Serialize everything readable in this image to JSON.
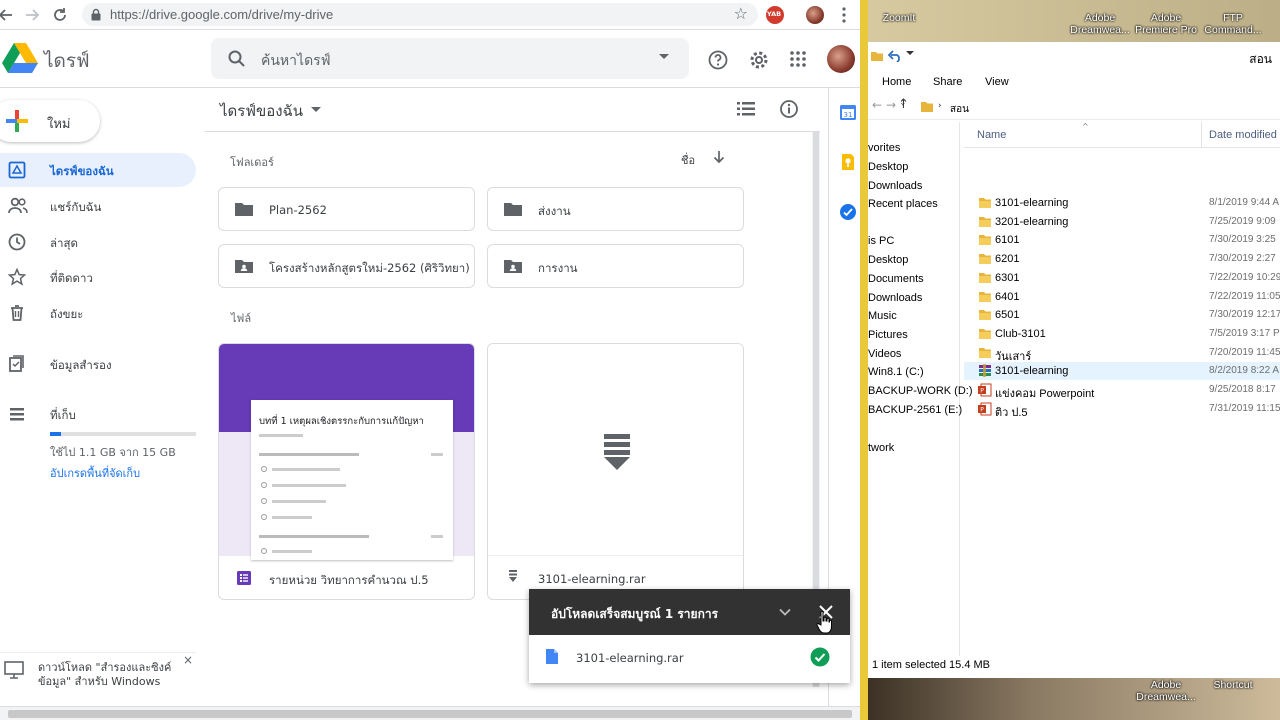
{
  "browser": {
    "url": "https://drive.google.com/drive/my-drive",
    "ext_label": "YAB"
  },
  "drive": {
    "logo_text": "ไดรฟ์",
    "search_placeholder": "ค้นหาไดรฟ์",
    "new_label": "ใหม่",
    "sidebar": [
      {
        "label": "ไดรฟ์ของฉัน",
        "icon": "my-drive-icon"
      },
      {
        "label": "แชร์กับฉัน",
        "icon": "shared-icon"
      },
      {
        "label": "ล่าสุด",
        "icon": "clock-icon"
      },
      {
        "label": "ที่ติดดาว",
        "icon": "star-icon"
      },
      {
        "label": "ถังขยะ",
        "icon": "trash-icon"
      },
      {
        "label": "ข้อมูลสำรอง",
        "icon": "backup-icon"
      },
      {
        "label": "ที่เก็บ",
        "icon": "storage-icon"
      }
    ],
    "storage": {
      "used_text": "ใช้ไป 1.1 GB จาก 15 GB",
      "upgrade_link": "อัปเกรดพื้นที่จัดเก็บ",
      "used_fraction": 0.073
    },
    "download_promo": "ดาวน์โหลด \"สำรองและซิงค์ข้อมูล\" สำหรับ Windows",
    "main_title": "ไดรฟ์ของฉัน",
    "folders_label": "โฟลเดอร์",
    "sort_label": "ชื่อ",
    "files_label": "ไฟล์",
    "folders": [
      {
        "name": "Plan-2562",
        "shared": false
      },
      {
        "name": "ส่งงาน",
        "shared": false
      },
      {
        "name": "โครงสร้างหลักสูตรใหม่-2562 (ศิริวิทยา)",
        "shared": true
      },
      {
        "name": "การงาน",
        "shared": true
      }
    ],
    "files": [
      {
        "name": "รายหน่วย วิทยาการคำนวณ ป.5",
        "type": "form",
        "preview_title": "บทที่ 1 เหตุผลเชิงตรรกะกับการแก้ปัญหา"
      },
      {
        "name": "3101-elearning.rar",
        "type": "archive"
      }
    ],
    "upload": {
      "title": "อัปโหลดเสร็จสมบูรณ์ 1 รายการ",
      "file": "3101-elearning.rar"
    },
    "colors": {
      "accent": "#1a73e8",
      "active_bg": "#e8f0fe",
      "toast_bg": "#323232",
      "success": "#0f9d58",
      "form_purple": "#673ab7"
    }
  },
  "explorer": {
    "title": "สอน",
    "ribbon_tabs": [
      "Home",
      "Share",
      "View"
    ],
    "path": "สอน",
    "columns": {
      "name": "Name",
      "date": "Date modified"
    },
    "nav": [
      "vorites",
      "Desktop",
      "Downloads",
      "Recent places",
      "is PC",
      "Desktop",
      "Documents",
      "Downloads",
      "Music",
      "Pictures",
      "Videos",
      "Win8.1 (C:)",
      "BACKUP-WORK (D:)",
      "BACKUP-2561 (E:)",
      "twork"
    ],
    "rows": [
      {
        "name": "3101-elearning",
        "date": "8/1/2019 9:44 A",
        "type": "folder"
      },
      {
        "name": "3201-elearning",
        "date": "7/25/2019 9:09",
        "type": "folder"
      },
      {
        "name": "6101",
        "date": "7/30/2019 3:25",
        "type": "folder"
      },
      {
        "name": "6201",
        "date": "7/30/2019 2:27",
        "type": "folder"
      },
      {
        "name": "6301",
        "date": "7/22/2019 10:29",
        "type": "folder"
      },
      {
        "name": "6401",
        "date": "7/22/2019 11:05",
        "type": "folder"
      },
      {
        "name": "6501",
        "date": "7/30/2019 12:17",
        "type": "folder"
      },
      {
        "name": "Club-3101",
        "date": "7/5/2019 3:17 P",
        "type": "folder"
      },
      {
        "name": "วันเสาร์",
        "date": "7/20/2019 11:45",
        "type": "folder"
      },
      {
        "name": "3101-elearning",
        "date": "8/2/2019 8:22 A",
        "type": "rar",
        "selected": true
      },
      {
        "name": "แข่งคอม Powerpoint",
        "date": "9/25/2018 8:17",
        "type": "ppt"
      },
      {
        "name": "ติว ป.5",
        "date": "7/31/2019 11:15",
        "type": "ppt"
      }
    ],
    "status": "1 item selected  15.4 MB"
  },
  "desktop": {
    "top_icons": [
      "ZoomIt",
      "Adobe Dreamwea...",
      "Adobe Premiere Pro",
      "FTP Command..."
    ],
    "bottom_icons": [
      "Adobe Dreamwea...",
      "Shortcut"
    ]
  }
}
